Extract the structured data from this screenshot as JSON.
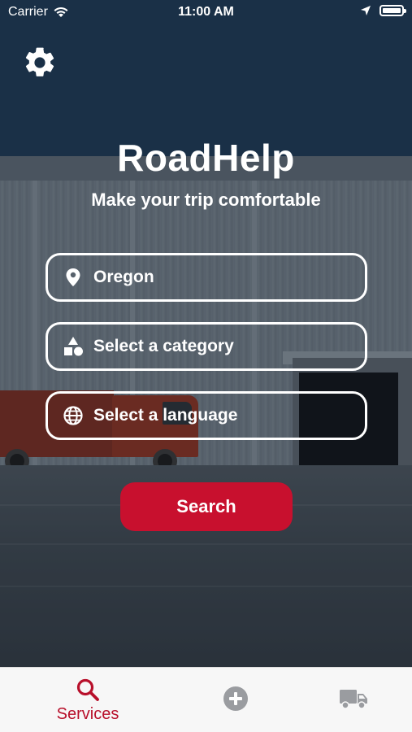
{
  "status_bar": {
    "carrier": "Carrier",
    "time": "11:00 AM"
  },
  "header": {
    "title": "RoadHelp",
    "subtitle": "Make your trip comfortable"
  },
  "form": {
    "location_value": "Oregon",
    "category_placeholder": "Select a category",
    "language_placeholder": "Select a language",
    "search_label": "Search"
  },
  "tabbar": {
    "tabs": [
      {
        "label": "Services",
        "icon": "search-icon",
        "active": true
      },
      {
        "label": "",
        "icon": "add-circle-icon",
        "active": false
      },
      {
        "label": "",
        "icon": "truck-icon",
        "active": false
      }
    ]
  },
  "colors": {
    "accent": "#c8102e",
    "tab_active": "#b8102b",
    "tab_inactive": "#9a9ca0",
    "tabbar_bg": "#f7f7f7"
  }
}
